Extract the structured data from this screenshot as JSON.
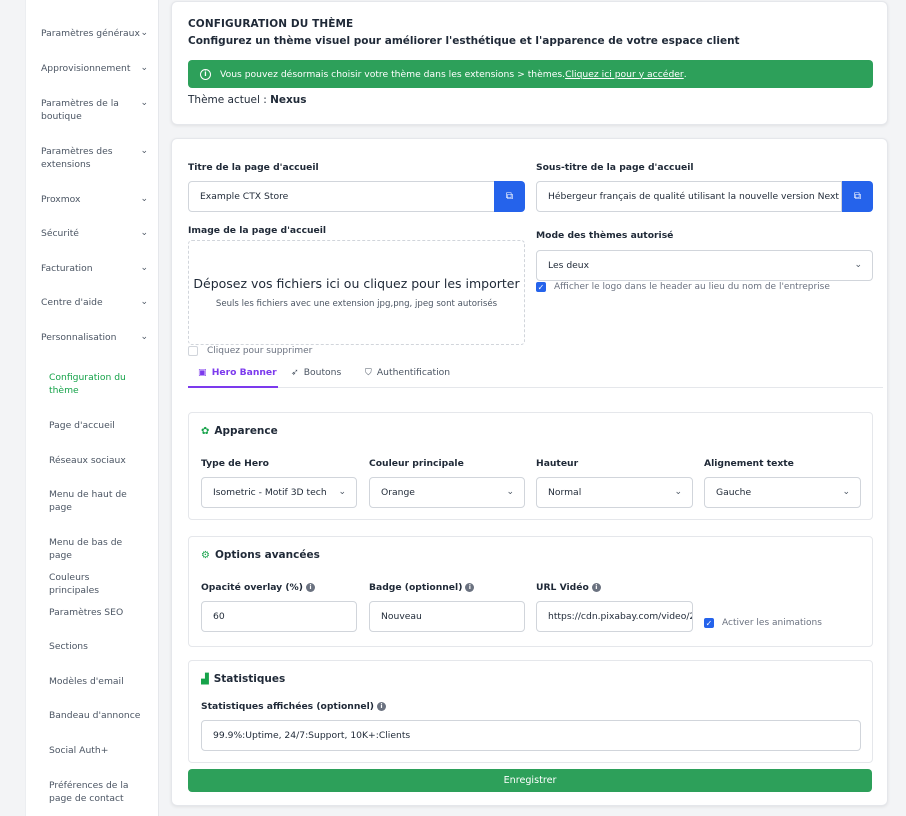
{
  "sidebar": {
    "items": [
      {
        "label": "Paramètres généraux"
      },
      {
        "label": "Approvisionnement"
      },
      {
        "label": "Paramètres de la boutique"
      },
      {
        "label": "Paramètres des extensions"
      },
      {
        "label": "Proxmox"
      },
      {
        "label": "Sécurité"
      },
      {
        "label": "Facturation"
      },
      {
        "label": "Centre d'aide"
      },
      {
        "label": "Personnalisation"
      }
    ],
    "subitems": [
      {
        "label": "Configuration du thème"
      },
      {
        "label": "Page d'accueil"
      },
      {
        "label": "Réseaux sociaux"
      },
      {
        "label": "Menu de haut de page"
      },
      {
        "label": "Menu de bas de page"
      },
      {
        "label": "Couleurs principales"
      },
      {
        "label": "Paramètres SEO"
      },
      {
        "label": "Sections"
      },
      {
        "label": "Modèles d'email"
      },
      {
        "label": "Bandeau d'annonce"
      },
      {
        "label": "Social Auth+"
      },
      {
        "label": "Préférences de la page de contact"
      }
    ],
    "chevron": "⌄"
  },
  "theme_card": {
    "title": "CONFIGURATION DU THÈME",
    "subtitle": "Configurez un thème visuel pour améliorer l'esthétique et l'apparence de votre espace client",
    "alert_text": "Vous pouvez désormais choisir votre thème dans les extensions > thèmes.",
    "alert_link": "Cliquez ici pour y accéder",
    "alert_suffix": ".",
    "current_label": "Thème actuel : ",
    "current_value": "Nexus"
  },
  "form": {
    "home_title_label": "Titre de la page d'accueil",
    "home_title_value": "Example CTX Store",
    "home_subtitle_label": "Sous-titre de la page d'accueil",
    "home_subtitle_value": "Hébergeur français de qualité utilisant la nouvelle version Next Gen",
    "home_image_label": "Image de la page d'accueil",
    "dropzone_title": "Déposez vos fichiers ici ou cliquez pour les importer",
    "dropzone_sub": "Seuls les fichiers avec une extension jpg,png, jpeg sont autorisés",
    "delete_label": "Cliquez pour supprimer",
    "theme_mode_label": "Mode des thèmes autorisé",
    "theme_mode_value": "Les deux",
    "logo_header_label": "Afficher le logo dans le header au lieu du nom de l'entreprise"
  },
  "tabs": [
    {
      "label": "Hero Banner",
      "icon": "image-icon"
    },
    {
      "label": "Boutons",
      "icon": "cursor-icon"
    },
    {
      "label": "Authentification",
      "icon": "shield-icon"
    }
  ],
  "appearance": {
    "title": "Apparence",
    "hero_type_label": "Type de Hero",
    "hero_type_value": "Isometric - Motif 3D tech",
    "main_color_label": "Couleur principale",
    "main_color_value": "Orange",
    "height_label": "Hauteur",
    "height_value": "Normal",
    "align_label": "Alignement texte",
    "align_value": "Gauche"
  },
  "advanced": {
    "title": "Options avancées",
    "opacity_label": "Opacité overlay (%)",
    "opacity_value": "60",
    "badge_label": "Badge (optionnel)",
    "badge_value": "Nouveau",
    "video_label": "URL Vidéo",
    "video_value": "https://cdn.pixabay.com/video/2",
    "animations_label": "Activer les animations"
  },
  "stats": {
    "title": "Statistiques",
    "shown_label": "Statistiques affichées (optionnel)",
    "shown_value": "99.9%:Uptime, 24/7:Support, 10K+:Clients"
  },
  "save_label": "Enregistrer",
  "colors": {
    "accent_green": "#2da05a",
    "accent_blue": "#2563eb",
    "tab_active": "#7c3aed"
  }
}
